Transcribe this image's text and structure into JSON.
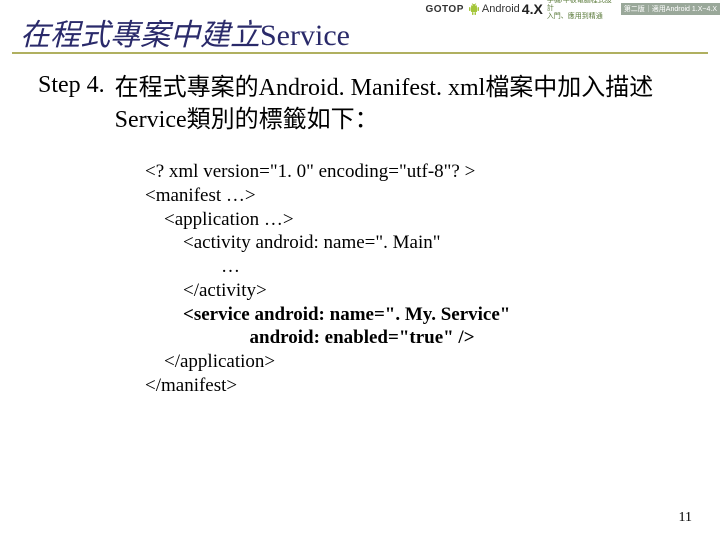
{
  "header": {
    "gotop": "GOTOP",
    "android_word": "Android",
    "fourx": "4.X",
    "book_line1": "手機/平板電腦程式設計",
    "book_line2": "入門、應用到精通",
    "part_badge": "第二版｜適用Android 1.X~4.X"
  },
  "title": {
    "zh": "在程式專案中建立",
    "latin": "Service"
  },
  "step": {
    "label": "Step 4.",
    "desc_part1": "在程式專案的",
    "desc_latin1": "Android. Manifest. xml",
    "desc_part2": "檔案中加入描述",
    "desc_latin2": "Service",
    "desc_part3": "類別的標籤如下："
  },
  "code": {
    "l1": "<? xml version=\"1. 0\" encoding=\"utf-8\"? >",
    "l2": "<manifest …>",
    "l3": "    <application …>",
    "l4": "        <activity android: name=\". Main\"",
    "l5": "                …",
    "l6": "        </activity>",
    "l7a": "        ",
    "l7b": "<service android: name=\". My. Service\"",
    "l8a": "                      ",
    "l8b": "android: enabled=\"true\" />",
    "l9": "    </application>",
    "l10": "</manifest>"
  },
  "page_number": "11"
}
